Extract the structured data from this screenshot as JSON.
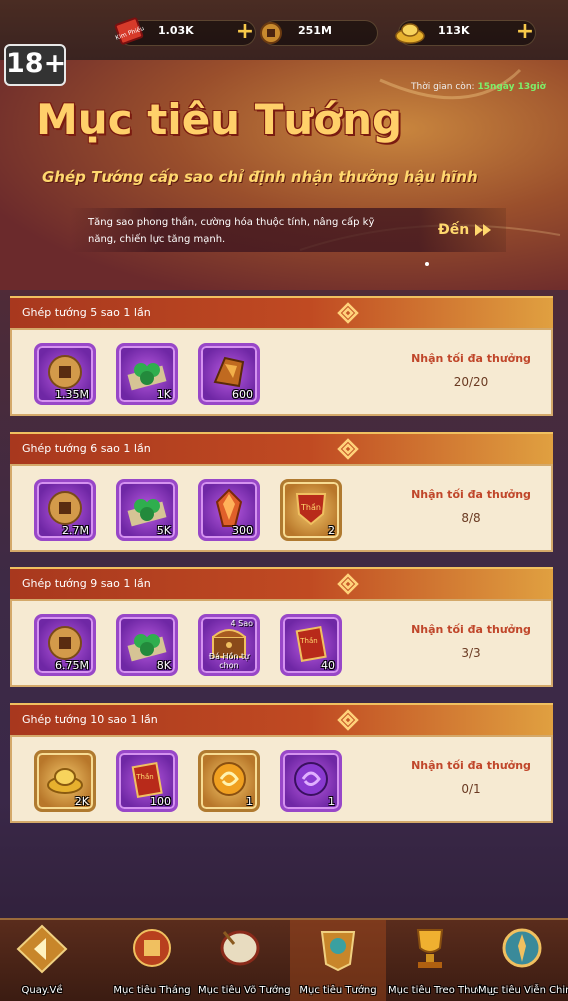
{
  "resources": [
    {
      "name": "Kim Phiếu",
      "icon": "ticket-icon",
      "value": "1.03K"
    },
    {
      "name": "Xu",
      "icon": "coin-icon",
      "value": "251M"
    },
    {
      "name": "Nguyên Bảo",
      "icon": "gold-ingot-icon",
      "value": "113K"
    }
  ],
  "resource_icon_text": "Kim Phiếu",
  "age_rating": "18+",
  "timer": {
    "label": "Thời gian còn:",
    "value": "15ngày 13giờ"
  },
  "event": {
    "title": "Mục tiêu Tướng",
    "subtitle": "Ghép Tướng cấp sao chỉ định nhận thưởng hậu hĩnh",
    "description": "Tăng sao phong thần, cường hóa thuộc tính, nâng cấp kỹ năng, chiến lực tăng mạnh.",
    "goto_label": "Đến"
  },
  "tasks": [
    {
      "title": "Ghép tướng 5 sao 1 lần",
      "reward_label": "Nhận tối đa thưởng",
      "progress": "20/20",
      "items": [
        {
          "icon": "coin-icon",
          "count": "1.35M",
          "frame": "purple"
        },
        {
          "icon": "jade-beads-icon",
          "count": "1K",
          "frame": "purple"
        },
        {
          "icon": "ore-icon",
          "count": "600",
          "frame": "purple"
        }
      ]
    },
    {
      "title": "Ghép tướng 6 sao 1 lần",
      "reward_label": "Nhận tối đa thưởng",
      "progress": "8/8",
      "items": [
        {
          "icon": "coin-icon",
          "count": "2.7M",
          "frame": "purple"
        },
        {
          "icon": "jade-beads-icon",
          "count": "5K",
          "frame": "purple"
        },
        {
          "icon": "crystal-icon",
          "count": "300",
          "frame": "purple"
        },
        {
          "icon": "shield-token-icon",
          "count": "2",
          "frame": "gold"
        }
      ]
    },
    {
      "title": "Ghép tướng 9 sao 1 lần",
      "reward_label": "Nhận tối đa thưởng",
      "progress": "3/3",
      "items": [
        {
          "icon": "coin-icon",
          "count": "6.75M",
          "frame": "purple"
        },
        {
          "icon": "jade-beads-icon",
          "count": "8K",
          "frame": "purple"
        },
        {
          "icon": "chest-icon",
          "count": "",
          "frame": "purple",
          "tag": "4 Sao",
          "name": "Đá Hồn tự chọn"
        },
        {
          "icon": "hero-card-icon",
          "count": "40",
          "frame": "purple"
        }
      ]
    },
    {
      "title": "Ghép tướng 10 sao 1 lần",
      "reward_label": "Nhận tối đa thưởng",
      "progress": "0/1",
      "items": [
        {
          "icon": "gold-ingot-icon",
          "count": "2K",
          "frame": "gold"
        },
        {
          "icon": "hero-card-icon",
          "count": "100",
          "frame": "purple"
        },
        {
          "icon": "gold-orb-icon",
          "count": "1",
          "frame": "gold"
        },
        {
          "icon": "purple-orb-icon",
          "count": "1",
          "frame": "purple"
        }
      ]
    }
  ],
  "card_icon_text": "Thần",
  "nav": [
    {
      "label": "Quay.Về",
      "icon": "back-arrow-icon"
    },
    {
      "label": "Mục tiêu Tháng",
      "icon": "month-goal-icon"
    },
    {
      "label": "Mục tiêu Võ Tướng",
      "icon": "drum-icon"
    },
    {
      "label": "Mục tiêu Tướng",
      "icon": "hero-goal-icon"
    },
    {
      "label": "Mục tiêu Treo Thưởng",
      "icon": "trophy-icon"
    },
    {
      "label": "Mục tiêu Viễn Chinh",
      "icon": "expedition-icon"
    }
  ],
  "colors": {
    "accent": "#ffd06a",
    "panel_bg": "#f6ead2",
    "header": "#c04a22",
    "reward_text": "#c0462a"
  }
}
